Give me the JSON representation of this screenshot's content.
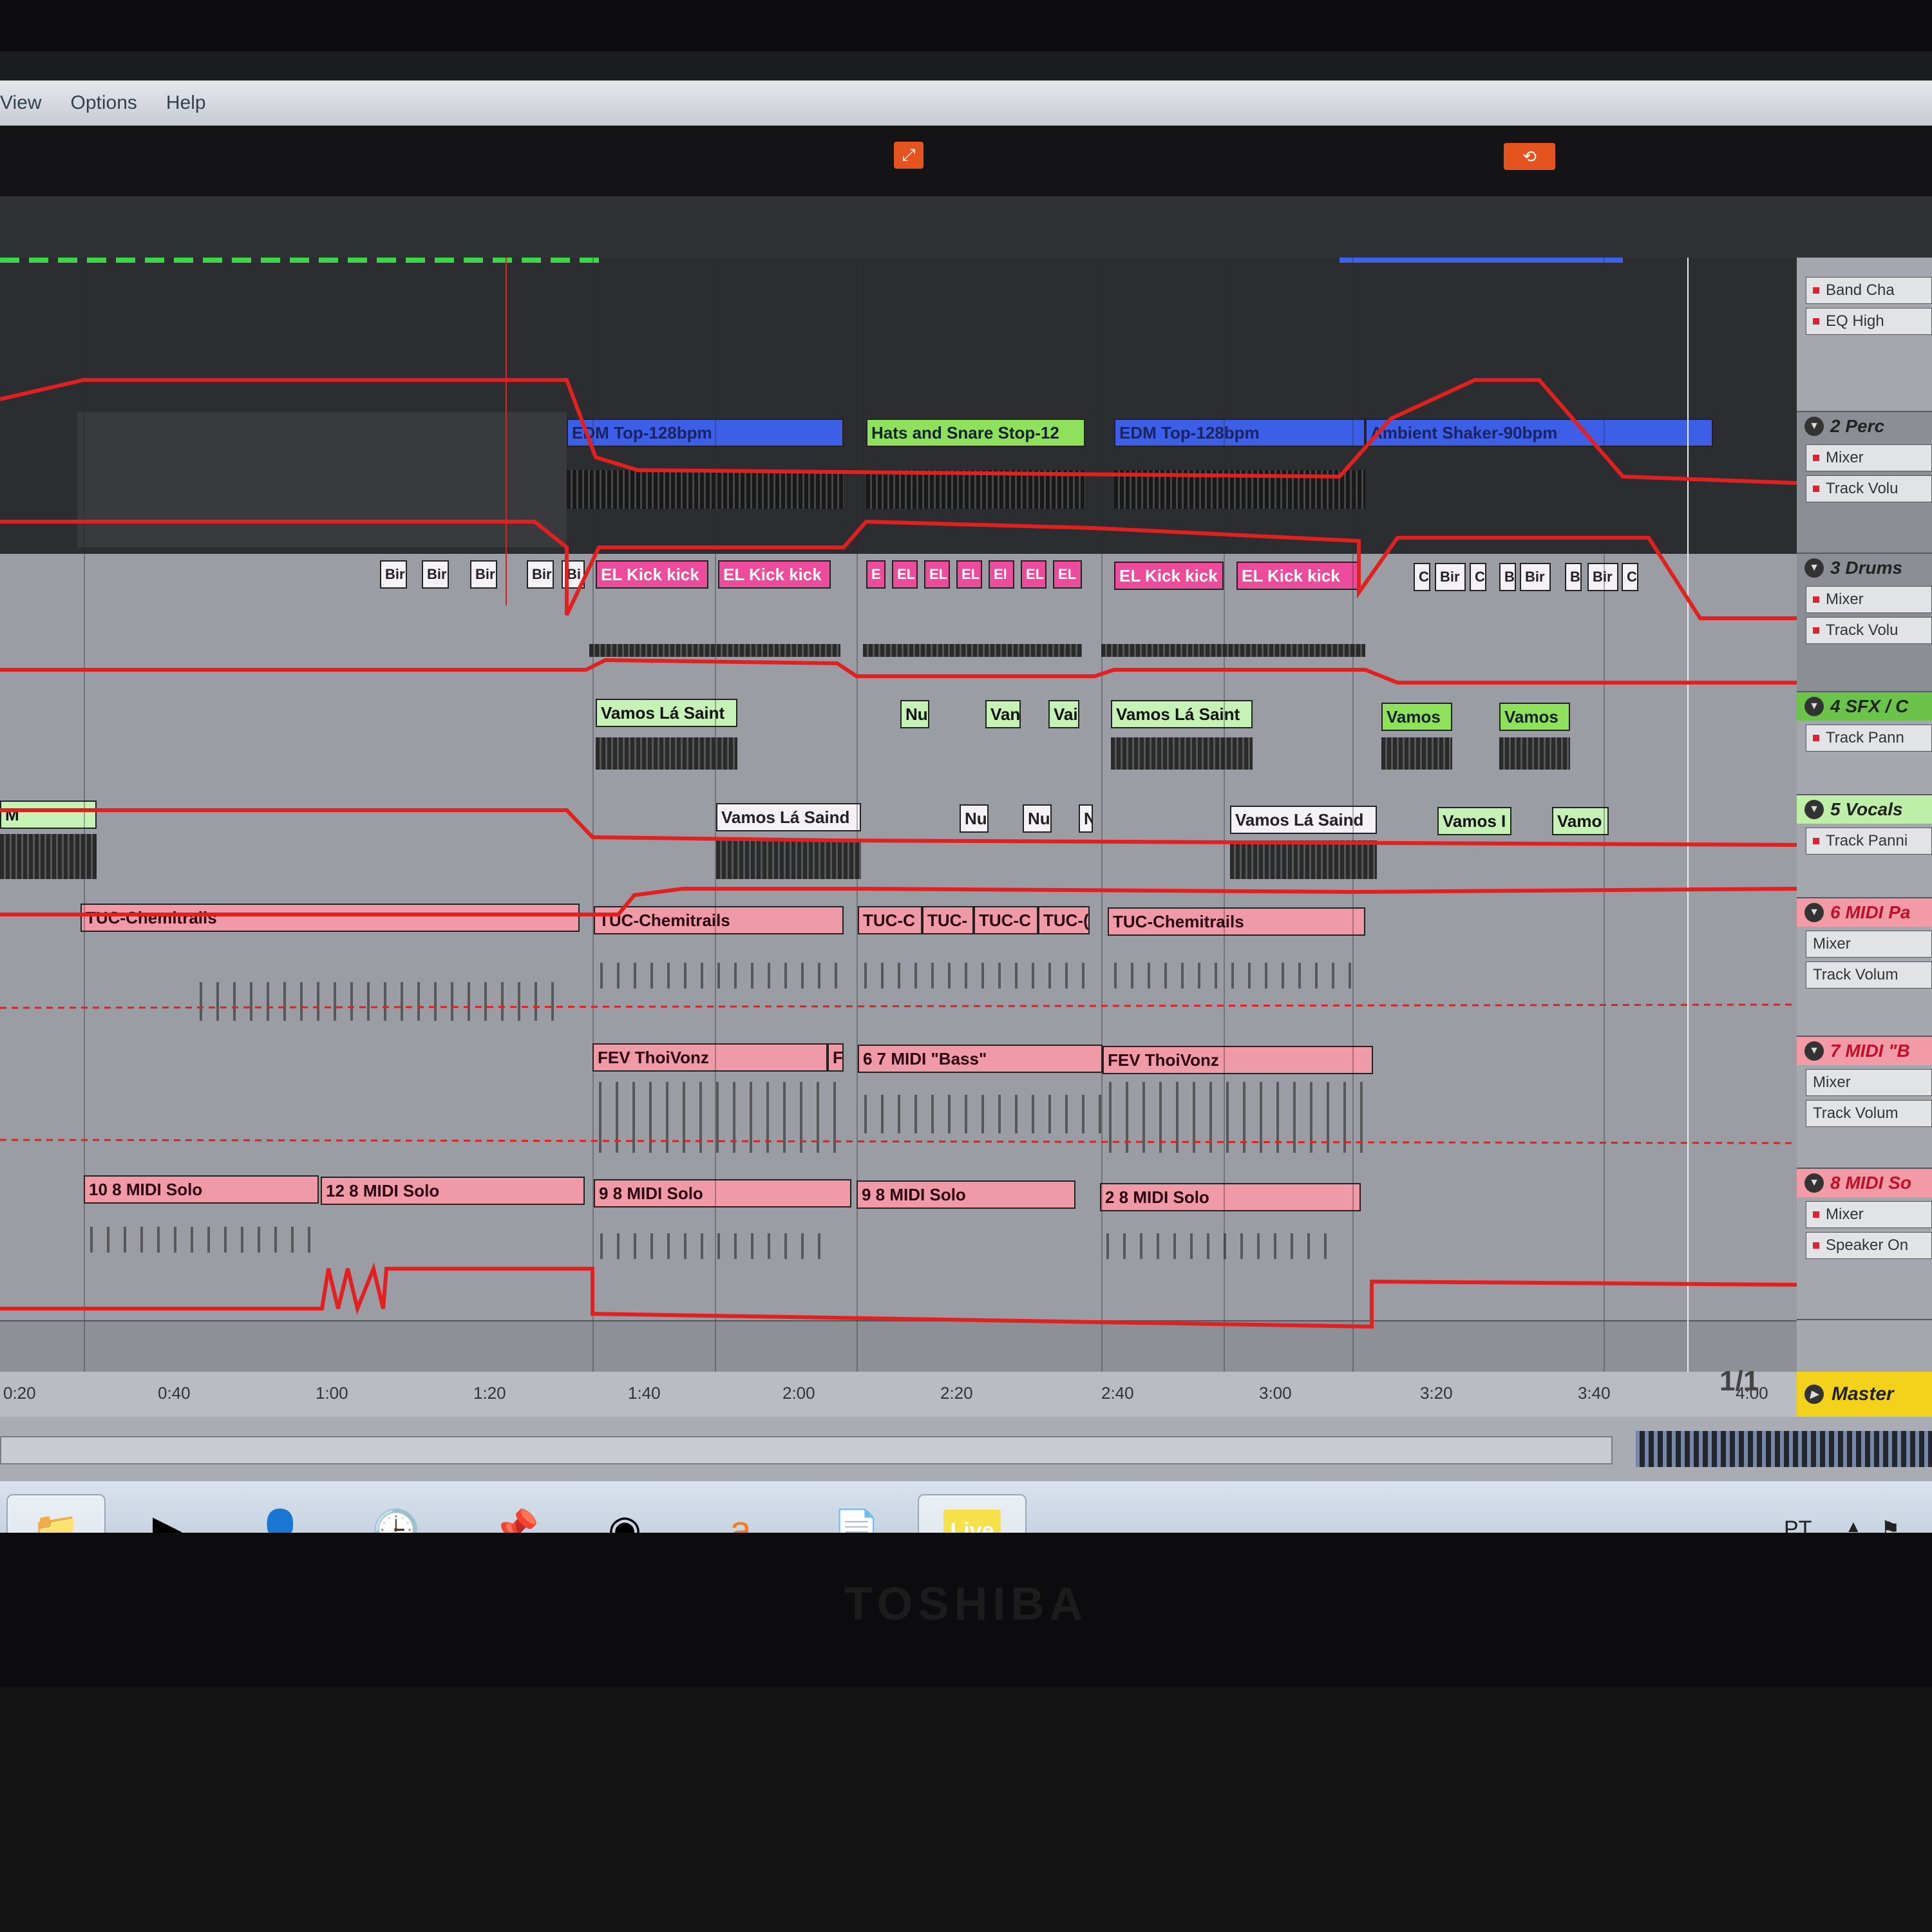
{
  "menu": [
    "View",
    "Options",
    "Help"
  ],
  "arrangement": {
    "track1_clips": [
      "EDM Top-128bpm",
      "Hats and Snare Stop-12",
      "EDM Top-128bpm",
      "Ambient Shaker-90bpm"
    ],
    "track2_clips": [
      "Bir",
      "Bir",
      "Bir",
      "Bir",
      "Bi",
      "EL Kick kick",
      "EL Kick kick",
      "E",
      "EL",
      "EL",
      "EL",
      "El",
      "EL",
      "EL",
      "EL Kick kick",
      "EL Kick kick",
      "C",
      "Bir",
      "C",
      "B",
      "Bir",
      "B",
      "Bir",
      "C"
    ],
    "track3_clips": [
      "Vamos Lá Saint",
      "Nu",
      "Van",
      "Vai",
      "Vamos Lá Saint",
      "Vamos",
      "Vamos"
    ],
    "track4_clips": [
      "M",
      "Vamos Lá Saind",
      "Nu",
      "Nu",
      "N",
      "Vamos Lá Saind",
      "Vamos I",
      "Vamo"
    ],
    "track5_clips": [
      "TUC-Chemitrails",
      "TUC-Chemitrails",
      "TUC-C",
      "TUC-",
      "TUC-C",
      "TUC-(",
      "TUC-Chemitrails"
    ],
    "track6_clips": [
      "FEV ThoiVonz",
      "F",
      "6 7 MIDI  \"Bass\"",
      "FEV ThoiVonz"
    ],
    "track7_clips": [
      "10 8 MIDI  Solo",
      "12 8 MIDI  Solo",
      "9 8 MIDI  Solo",
      "9 8 MIDI  Solo",
      "2 8 MIDI  Solo"
    ]
  },
  "headers": {
    "top_rows": [
      "Band Cha",
      "EQ High"
    ],
    "t2": {
      "title": "2 Perc",
      "rows": [
        "Mixer",
        "Track Volu"
      ]
    },
    "t3": {
      "title": "3 Drums",
      "rows": [
        "Mixer",
        "Track Volu"
      ]
    },
    "t4": {
      "title": "4 SFX / C",
      "rows": [
        "Track Pann"
      ]
    },
    "t5": {
      "title": "5 Vocals",
      "rows": [
        "Track Panni"
      ]
    },
    "t6": {
      "title": "6 MIDI Pa",
      "rows": [
        "Mixer",
        "Track Volum"
      ]
    },
    "t7": {
      "title": "7 MIDI \"B",
      "rows": [
        "Mixer",
        "Track Volum"
      ]
    },
    "t8": {
      "title": "8 MIDI So",
      "rows": [
        "Mixer",
        "Speaker On"
      ]
    }
  },
  "timeline": {
    "ticks": [
      "0:20",
      "0:40",
      "1:00",
      "1:20",
      "1:40",
      "2:00",
      "2:20",
      "2:40",
      "3:00",
      "3:20",
      "3:40",
      "4:00"
    ],
    "page_indicator": "1/1",
    "master_label": "Master"
  },
  "taskbar": {
    "icons": [
      "folder-icon",
      "media-player-icon",
      "user-icon",
      "clock-icon",
      "pin-icon",
      "chrome-icon",
      "avast-icon",
      "notepad-icon",
      "ableton-live-icon"
    ],
    "live_label": "Live",
    "lang": "PT"
  },
  "bezel_brand": "TOSHIBA",
  "colors": {
    "automation": "#e41f1f",
    "clip_blue": "#3d5ee6",
    "clip_green": "#8fe05a",
    "clip_pink": "#f09aa8",
    "clip_hotpink": "#ec4c9b",
    "accent_orange": "#e5541e",
    "master_yellow": "#f4d21c"
  }
}
